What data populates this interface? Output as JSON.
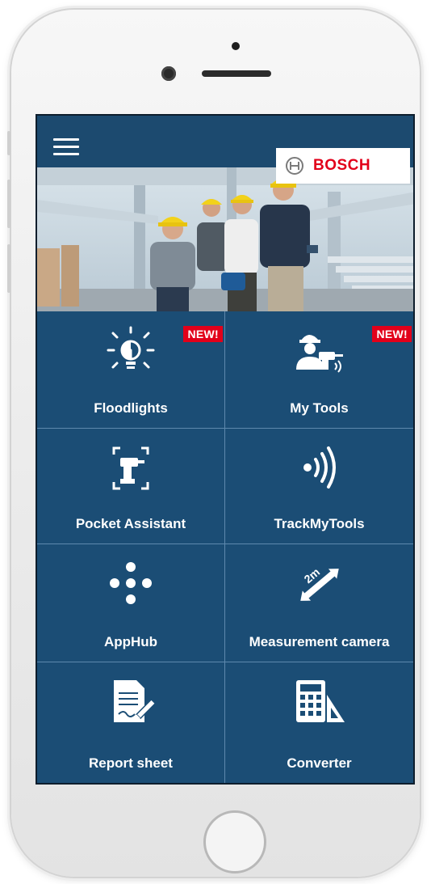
{
  "app": {
    "brand": "BOSCH",
    "menu_icon": "hamburger-menu-icon",
    "logo_icon": "bosch-armature-logo-icon"
  },
  "colors": {
    "screen_bg": "#1b4d75",
    "topbar_bg": "#1c4a6f",
    "tile_divider": "#5e89ad",
    "brand_red": "#e2001a",
    "text": "#ffffff"
  },
  "hero": {
    "description_icon": "construction-workers-photo"
  },
  "tiles": [
    {
      "label": "Floodlights",
      "icon": "lightbulb-icon",
      "badge": "NEW!"
    },
    {
      "label": "My Tools",
      "icon": "worker-with-drill-icon",
      "badge": "NEW!"
    },
    {
      "label": "Pocket Assistant",
      "icon": "drill-scan-icon",
      "badge": ""
    },
    {
      "label": "TrackMyTools",
      "icon": "signal-waves-icon",
      "badge": ""
    },
    {
      "label": "AppHub",
      "icon": "dots-hub-icon",
      "badge": ""
    },
    {
      "label": "Measurement camera",
      "icon": "measuring-tape-icon",
      "badge": "",
      "icon_text": "2m"
    },
    {
      "label": "Report sheet",
      "icon": "document-pen-icon",
      "badge": ""
    },
    {
      "label": "Converter",
      "icon": "calculator-triangle-icon",
      "badge": ""
    }
  ]
}
